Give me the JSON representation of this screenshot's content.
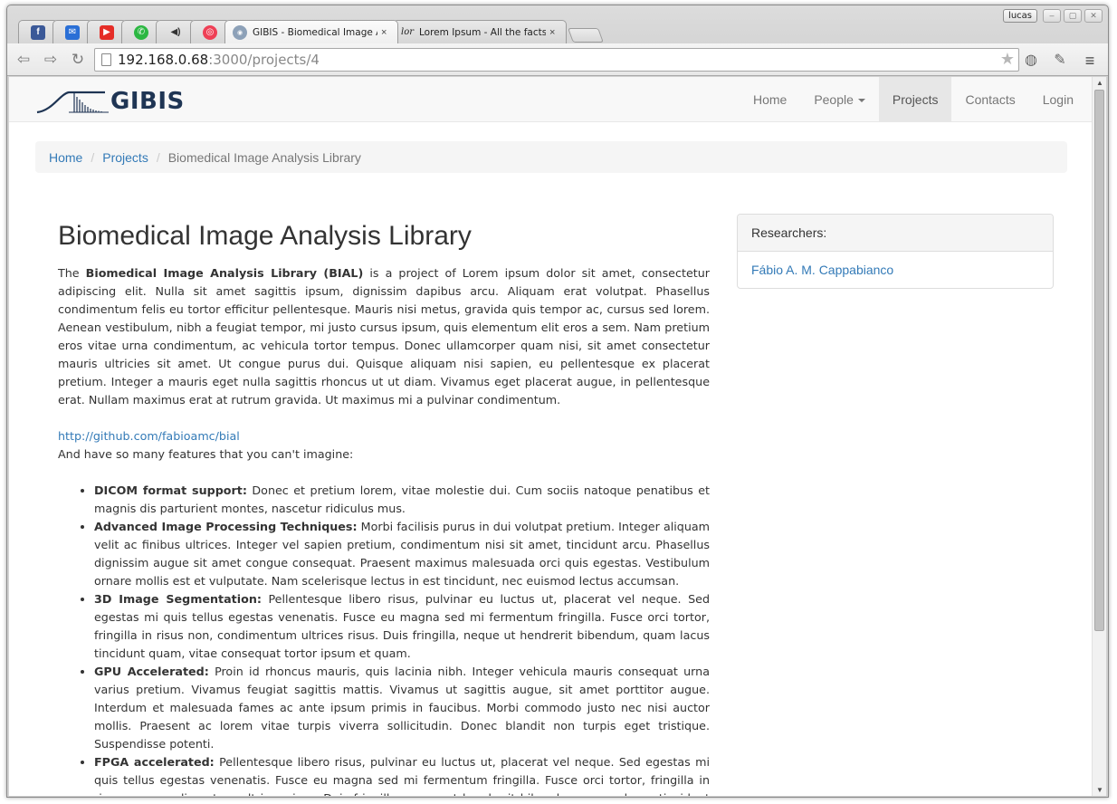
{
  "browser": {
    "user_name": "lucas",
    "tabs": [
      {
        "title": "",
        "icon": "facebook-icon"
      },
      {
        "title": "",
        "icon": "mail-icon"
      },
      {
        "title": "",
        "icon": "youtube-icon"
      },
      {
        "title": "",
        "icon": "whatsapp-icon"
      },
      {
        "title": "",
        "icon": "speaker-icon"
      },
      {
        "title": "",
        "icon": "pocket-icon"
      },
      {
        "title": "GIBIS - Biomedical Image An",
        "icon": "gibis-favicon",
        "close": "×"
      },
      {
        "title": "Lorem Ipsum - All the facts -",
        "icon": "lorem-favicon",
        "favicon_text": "lor",
        "close": "×"
      }
    ],
    "url_host": "192.168.0.68",
    "url_path": ":3000/projects/4"
  },
  "site": {
    "brand": "GIBIS",
    "nav": {
      "home": "Home",
      "people": "People",
      "projects": "Projects",
      "contacts": "Contacts",
      "login": "Login"
    }
  },
  "breadcrumb": {
    "home": "Home",
    "projects": "Projects",
    "current": "Biomedical Image Analysis Library",
    "separator": "/"
  },
  "project": {
    "title": "Biomedical Image Analysis Library",
    "intro_prefix": "The ",
    "intro_bold": "Biomedical Image Analysis Library (BIAL)",
    "intro_rest": " is a project of Lorem ipsum dolor sit amet, consectetur adipiscing elit. Nulla sit amet sagittis ipsum, dignissim dapibus arcu. Aliquam erat volutpat. Phasellus condimentum felis eu tortor efficitur pellentesque. Mauris nisi metus, gravida quis tempor ac, cursus sed lorem. Aenean vestibulum, nibh a feugiat tempor, mi justo cursus ipsum, quis elementum elit eros a sem. Nam pretium eros vitae urna condimentum, ac vehicula tortor tempus. Donec ullamcorper quam nisi, sit amet consectetur mauris ultricies sit amet. Ut congue purus dui. Quisque aliquam nisi sapien, eu pellentesque ex placerat pretium. Integer a mauris eget nulla sagittis rhoncus ut ut diam. Vivamus eget placerat augue, in pellentesque erat. Nullam maximus erat at rutrum gravida. Ut maximus mi a pulvinar condimentum.",
    "repo_link": "http://github.com/fabioamc/bial",
    "features_intro": "And have so many features that you can't imagine:",
    "features": [
      {
        "name": "DICOM format support:",
        "text": " Donec et pretium lorem, vitae molestie dui. Cum sociis natoque penatibus et magnis dis parturient montes, nascetur ridiculus mus."
      },
      {
        "name": "Advanced Image Processing Techniques:",
        "text": " Morbi facilisis purus in dui volutpat pretium. Integer aliquam velit ac finibus ultrices. Integer vel sapien pretium, condimentum nisi sit amet, tincidunt arcu. Phasellus dignissim augue sit amet congue consequat. Praesent maximus malesuada orci quis egestas. Vestibulum ornare mollis est et vulputate. Nam scelerisque lectus in est tincidunt, nec euismod lectus accumsan."
      },
      {
        "name": "3D Image Segmentation:",
        "text": " Pellentesque libero risus, pulvinar eu luctus ut, placerat vel neque. Sed egestas mi quis tellus egestas venenatis. Fusce eu magna sed mi fermentum fringilla. Fusce orci tortor, fringilla in risus non, condimentum ultrices risus. Duis fringilla, neque ut hendrerit bibendum, quam lacus tincidunt quam, vitae consequat tortor ipsum et quam."
      },
      {
        "name": "GPU Accelerated:",
        "text": " Proin id rhoncus mauris, quis lacinia nibh. Integer vehicula mauris consequat urna varius pretium. Vivamus feugiat sagittis mattis. Vivamus ut sagittis augue, sit amet porttitor augue. Interdum et malesuada fames ac ante ipsum primis in faucibus. Morbi commodo justo nec nisi auctor mollis. Praesent ac lorem vitae turpis viverra sollicitudin. Donec blandit non turpis eget tristique. Suspendisse potenti."
      },
      {
        "name": "FPGA accelerated:",
        "text": " Pellentesque libero risus, pulvinar eu luctus ut, placerat vel neque. Sed egestas mi quis tellus egestas venenatis. Fusce eu magna sed mi fermentum fringilla. Fusce orci tortor, fringilla in risus non, condimentum ultrices risus. Duis fringilla, neque ut hendrerit bibendum, quam lacus tincidunt quam, vitae consequat tortor ipsum et quam. Duis fringilla, neque ut hendrerit bibendum, quam lacus tincidunt quam."
      }
    ]
  },
  "researchers": {
    "heading": "Researchers:",
    "names": [
      "Fábio A. M. Cappabianco"
    ]
  },
  "colors": {
    "link": "#337ab7",
    "brand": "#1f3554",
    "nav_active": "#e7e7e7"
  }
}
